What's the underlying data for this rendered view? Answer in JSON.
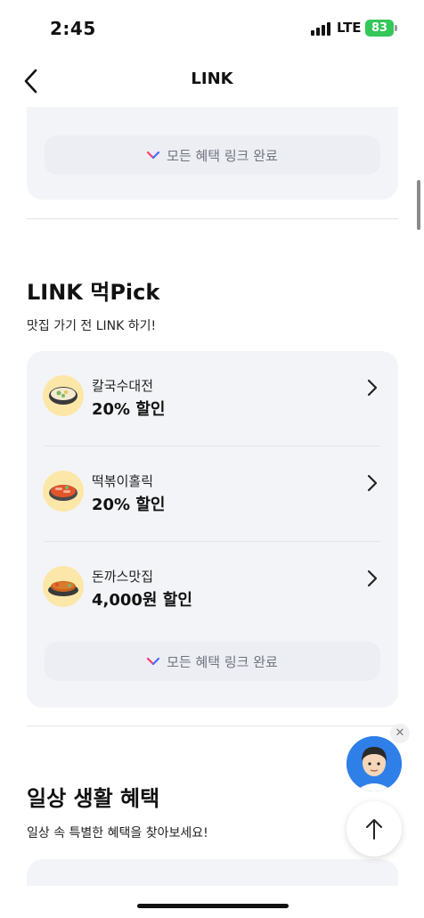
{
  "status_bar": {
    "time": "2:45",
    "network": "LTE",
    "battery": "83"
  },
  "nav": {
    "title": "LINK",
    "back_icon": "chevron-left-icon"
  },
  "link_all_label": "모든 혜택 링크 완료",
  "section_pick": {
    "title": "LINK 먹Pick",
    "subtitle": "맛집 가기 전 LINK 하기!",
    "items": [
      {
        "name": "칼국수대전",
        "discount": "20% 할인",
        "icon": "noodle-bowl-icon"
      },
      {
        "name": "떡볶이홀릭",
        "discount": "20% 할인",
        "icon": "tteokbokki-icon"
      },
      {
        "name": "돈까스맛집",
        "discount": "4,000원 할인",
        "icon": "tonkatsu-icon"
      }
    ]
  },
  "section_daily": {
    "title": "일상 생활 혜택",
    "subtitle": "일상 속 특별한 혜택을 찾아보세요!"
  },
  "colors": {
    "card_bg": "#f3f4f8",
    "check_accent_1": "#ff3d6e",
    "check_accent_2": "#4a6cff",
    "fab_blue": "#2f7fe8"
  }
}
